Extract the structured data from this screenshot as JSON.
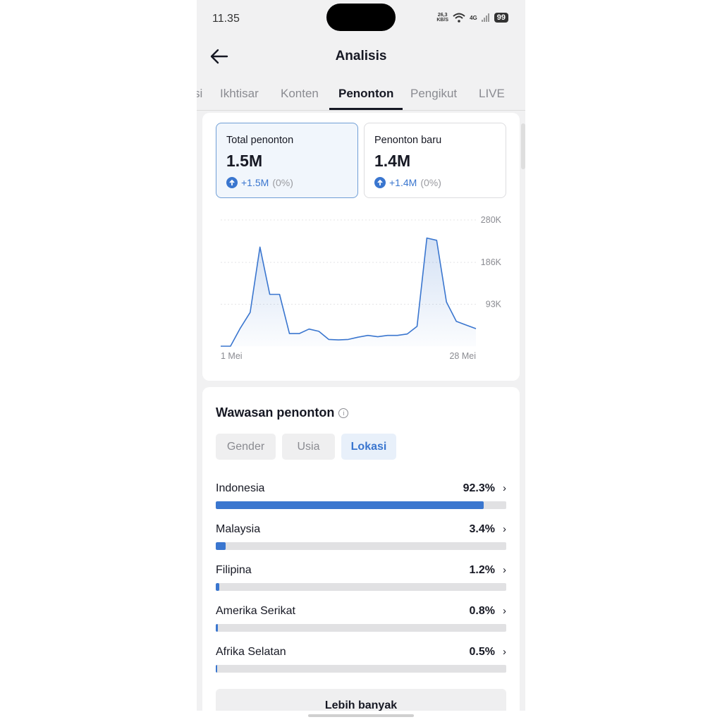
{
  "status": {
    "time": "11.35",
    "net_speed": "26,3",
    "net_unit": "KB/S",
    "signal": "4G",
    "battery": "99"
  },
  "header": {
    "title": "Analisis"
  },
  "tabs": [
    {
      "label": "si",
      "active": false
    },
    {
      "label": "Ikhtisar",
      "active": false
    },
    {
      "label": "Konten",
      "active": false
    },
    {
      "label": "Penonton",
      "active": true
    },
    {
      "label": "Pengikut",
      "active": false
    },
    {
      "label": "LIVE",
      "active": false
    }
  ],
  "metrics": [
    {
      "label": "Total penonton",
      "value": "1.5M",
      "delta": "+1.5M",
      "delta_pct": "(0%)",
      "selected": true
    },
    {
      "label": "Penonton baru",
      "value": "1.4M",
      "delta": "+1.4M",
      "delta_pct": "(0%)",
      "selected": false
    }
  ],
  "chart_data": {
    "type": "area",
    "x_start_label": "1 Mei",
    "x_end_label": "28 Mei",
    "yticks": [
      "280K",
      "186K",
      "93K"
    ],
    "ytick_values": [
      280000,
      186000,
      93000
    ],
    "ylim": [
      0,
      280000
    ],
    "grid": true,
    "color": "#3a76cf",
    "values": [
      0,
      0,
      40000,
      75000,
      220000,
      115000,
      115000,
      28000,
      28000,
      38000,
      33000,
      15000,
      14000,
      15000,
      20000,
      24000,
      21000,
      24000,
      24000,
      27000,
      44000,
      240000,
      235000,
      98000,
      55000,
      47000,
      39000
    ]
  },
  "insights": {
    "title": "Wawasan penonton",
    "info_icon": "i",
    "filters": [
      {
        "label": "Gender",
        "active": false
      },
      {
        "label": "Usia",
        "active": false
      },
      {
        "label": "Lokasi",
        "active": true
      }
    ],
    "locations": [
      {
        "name": "Indonesia",
        "pct_label": "92.3%",
        "pct": 92.3
      },
      {
        "name": "Malaysia",
        "pct_label": "3.4%",
        "pct": 3.4
      },
      {
        "name": "Filipina",
        "pct_label": "1.2%",
        "pct": 1.2
      },
      {
        "name": "Amerika Serikat",
        "pct_label": "0.8%",
        "pct": 0.8
      },
      {
        "name": "Afrika Selatan",
        "pct_label": "0.5%",
        "pct": 0.5
      }
    ],
    "more_label": "Lebih banyak"
  }
}
